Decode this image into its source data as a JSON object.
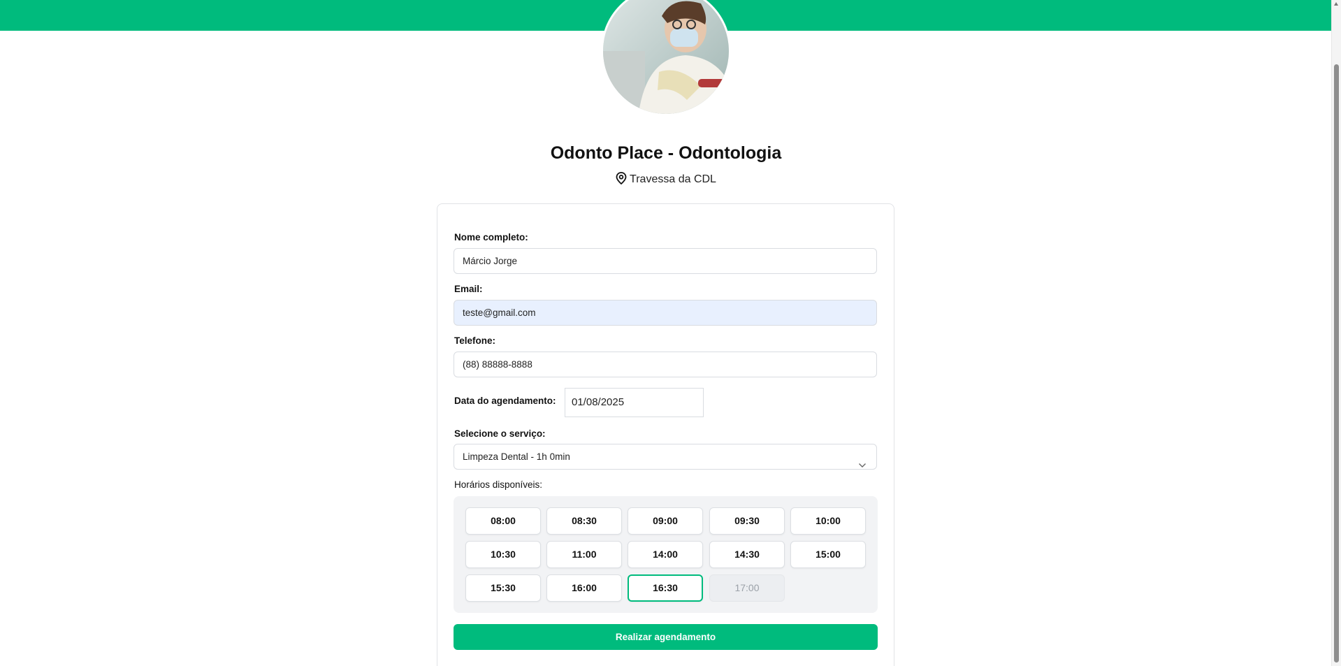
{
  "colors": {
    "accent": "#00bb7d",
    "autofill": "#e8f0fe",
    "panel": "#f2f3f5"
  },
  "header": {
    "clinic_name": "Odonto Place - Odontologia",
    "address": "Travessa da CDL",
    "location_icon": "map-pin-icon"
  },
  "form": {
    "name_label": "Nome completo:",
    "name_value": "Márcio Jorge",
    "email_label": "Email:",
    "email_value": "teste@gmail.com",
    "phone_label": "Telefone:",
    "phone_value": "(88) 88888-8888",
    "date_label": "Data do agendamento:",
    "date_value": "01/08/2025",
    "service_label": "Selecione o serviço:",
    "service_value": "Limpeza Dental - 1h 0min",
    "slots_label": "Horários disponíveis:",
    "slots": [
      {
        "time": "08:00",
        "state": "available"
      },
      {
        "time": "08:30",
        "state": "available"
      },
      {
        "time": "09:00",
        "state": "available"
      },
      {
        "time": "09:30",
        "state": "available"
      },
      {
        "time": "10:00",
        "state": "available"
      },
      {
        "time": "10:30",
        "state": "available"
      },
      {
        "time": "11:00",
        "state": "available"
      },
      {
        "time": "14:00",
        "state": "available"
      },
      {
        "time": "14:30",
        "state": "available"
      },
      {
        "time": "15:00",
        "state": "available"
      },
      {
        "time": "15:30",
        "state": "available"
      },
      {
        "time": "16:00",
        "state": "available"
      },
      {
        "time": "16:30",
        "state": "selected"
      },
      {
        "time": "17:00",
        "state": "disabled"
      }
    ],
    "submit_label": "Realizar agendamento"
  }
}
